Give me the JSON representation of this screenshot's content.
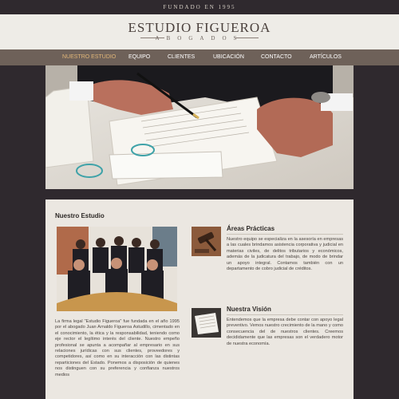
{
  "topbar": {
    "founded": "FUNDADO EN 1995"
  },
  "header": {
    "title": "ESTUDIO FIGUEROA",
    "subtitle": "ABOGADOS"
  },
  "nav": {
    "items": [
      {
        "label": "NUESTRO ESTUDIO",
        "active": true
      },
      {
        "label": "EQUIPO"
      },
      {
        "label": "CLIENTES"
      },
      {
        "label": "UBICACIÓN"
      },
      {
        "label": "CONTACTO"
      },
      {
        "label": "ARTÍCULOS"
      }
    ]
  },
  "about": {
    "title": "Nuestro Estudio",
    "text": "La firma legal \"Estudio Figueroa\" fue fundada en el año 1995 por el abogado Juan Arnaldo Figueroa Astudillo, cimentado en el conocimiento, la ética y la responsabilidad, teniendo como eje rector el legítimo interés del cliente. Nuestro empeño profesional se apunta a acompañar al empresario en sus relaciones jurídicas con sus clientes, proveedores y competidores, así como en su interacción con las distintas reparticiones del Estado. Ponemos a disposición de quienes nos distinguen con su preferencia y confianza nuestros medios"
  },
  "practice": {
    "title": "Áreas Prácticas",
    "text": "Nuestro equipo se especializa en la asesoría en empresas a las cuales brindamos asistencia corporativa y judicial en materias civiles, de delitos tributarios y económicos, además de la judicatura del trabajo, de modo de brindar un apoyo integral. Contamos también con un departamento de cobro judicial de créditos."
  },
  "vision": {
    "title": "Nuestra Visión",
    "text": "Entendemos que la empresa debe contar con apoyo legal preventivo. Vemos nuestro crecimiento de la mano y como consecuencia del de nuestros clientes. Creemos decididamente que las empresas son el verdadero motor de nuestra economía."
  },
  "colors": {
    "dark": "#2f292e",
    "nav": "#6e6159",
    "accent": "#e1b678",
    "panel": "#ebe7e1"
  }
}
